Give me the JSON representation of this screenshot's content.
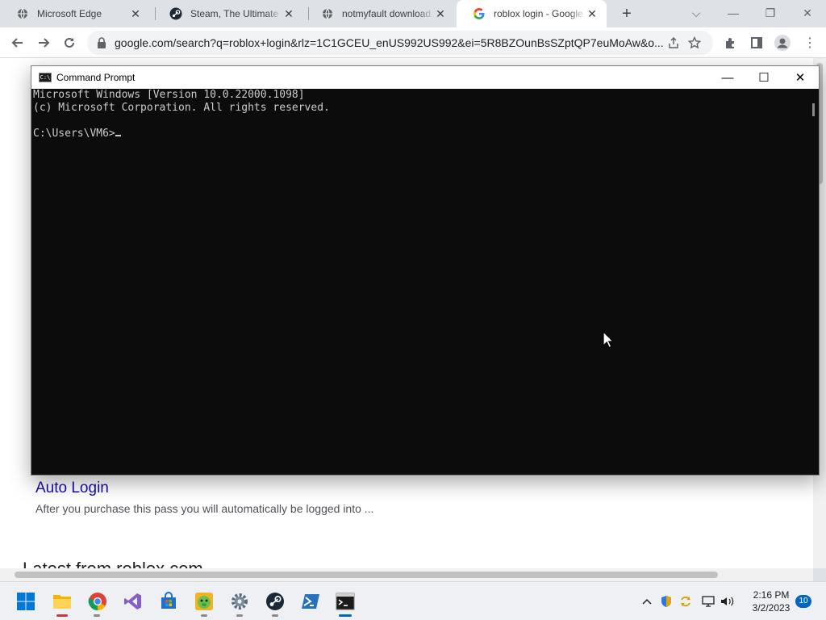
{
  "browser": {
    "tabs": [
      {
        "title": "Microsoft Edge",
        "favicon": "globe-icon",
        "active": false
      },
      {
        "title": "Steam, The Ultimate Online Game Platform",
        "favicon": "steam-icon",
        "active": false
      },
      {
        "title": "notmyfault download - Google Search",
        "favicon": "globe-icon",
        "active": false
      },
      {
        "title": "roblox login - Google Search",
        "favicon": "google-icon",
        "active": true
      }
    ],
    "address": "google.com/search?q=roblox+login&rlz=1C1GCEU_enUS992US992&ei=5R8BZOunBsSZptQP7euMoAw&o..."
  },
  "page": {
    "result_title": "Auto Login",
    "result_snippet": "After you purchase this pass you will automatically be logged into ...",
    "next_heading": "Latest from roblox.com"
  },
  "cmd": {
    "title": "Command Prompt",
    "lines": [
      "Microsoft Windows [Version 10.0.22000.1098]",
      "(c) Microsoft Corporation. All rights reserved.",
      "",
      "C:\\Users\\VM6>"
    ]
  },
  "taskbar": {
    "apps": [
      "start-icon",
      "file-explorer-icon",
      "chrome-icon",
      "visual-studio-icon",
      "store-icon",
      "game-icon",
      "settings-icon",
      "steam-icon",
      "powershell-icon",
      "command-prompt-icon"
    ],
    "time": "2:16 PM",
    "date": "3/2/2023",
    "notification_count": "10"
  },
  "colors": {
    "link": "#1a0dab",
    "accent": "#0067c0",
    "console_bg": "#0c0c0c",
    "console_fg": "#cccccc"
  }
}
